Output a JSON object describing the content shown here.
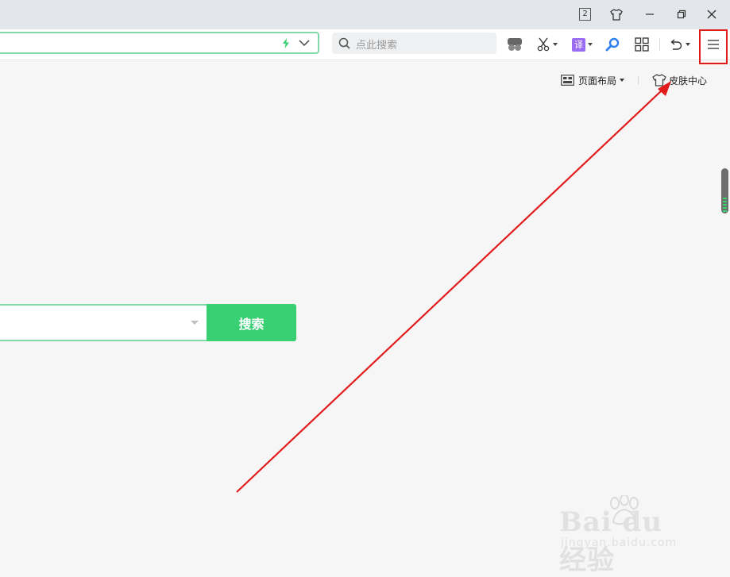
{
  "window": {
    "tab_count": "2",
    "buttons": [
      "skin-icon",
      "minimize-icon",
      "restore-icon",
      "close-icon"
    ]
  },
  "search": {
    "placeholder": "点此搜索"
  },
  "toolbar": {
    "translate_label": "译",
    "accent": "#39cf73",
    "translate_color": "#9b6df2"
  },
  "page_links": {
    "layout_label": "页面布局",
    "skin_label": "皮肤中心"
  },
  "main_search": {
    "button_label": "搜索"
  },
  "watermark": {
    "brand": "Bai du 经验",
    "url": "jingyan.baidu.com"
  },
  "annotation": {
    "highlight_color": "#e11b1b"
  }
}
